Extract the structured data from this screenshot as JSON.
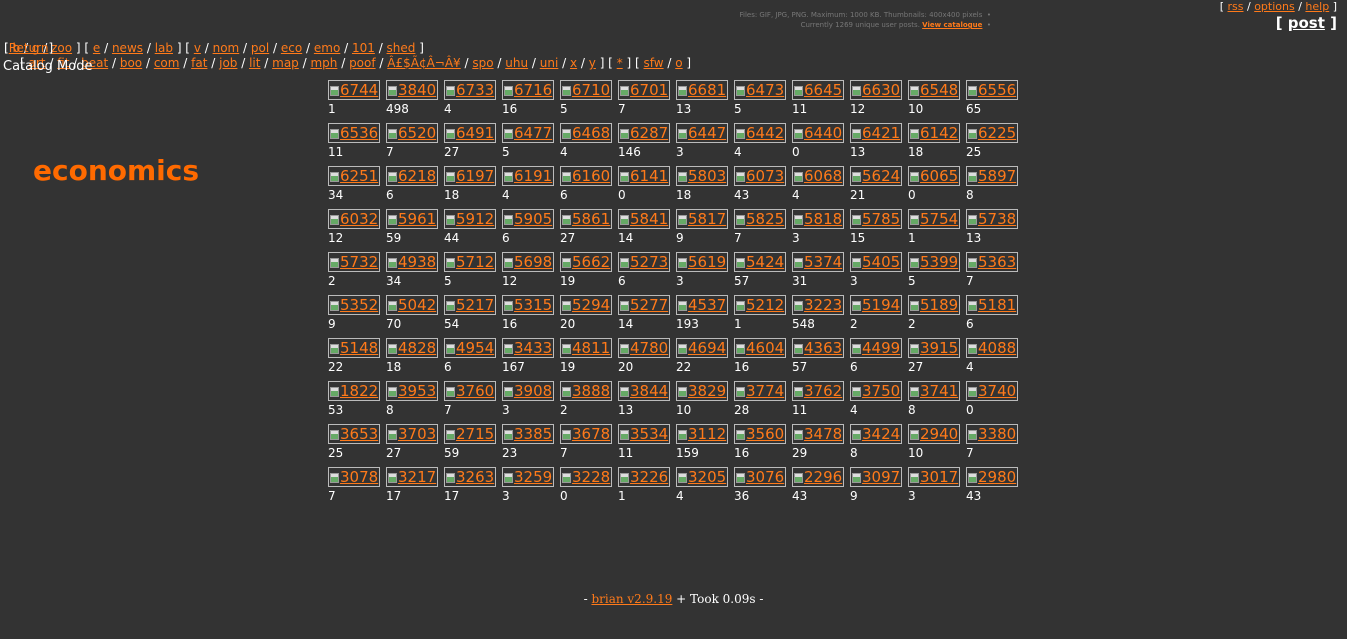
{
  "top": {
    "rss": "rss",
    "options": "options",
    "help": "help",
    "post": "post"
  },
  "info": {
    "line1": "Files: GIF, JPG, PNG. Maximum: 1000 KB. Thumbnails: 400x400 pixels",
    "line2": "Currently 1269 unique user posts.",
    "catalogue": "View catalogue"
  },
  "nav": {
    "row1": [
      "b",
      "g",
      "zoo",
      "e",
      "news",
      "lab",
      "v",
      "nom",
      "pol",
      "eco",
      "emo",
      "101",
      "shed"
    ],
    "row2": [
      "art",
      "fit",
      "beat",
      "boo",
      "com",
      "fat",
      "job",
      "lit",
      "map",
      "mph",
      "poof",
      "Â£$Ã¢Â¬Â¥",
      "spo",
      "uhu",
      "uni",
      "x",
      "y",
      "*",
      "sfw",
      "o"
    ]
  },
  "return_label": "Return",
  "mode_label": "Catalog Mode",
  "board_title": "economics",
  "threads": [
    {
      "id": "6744",
      "count": "1"
    },
    {
      "id": "3840",
      "count": "498"
    },
    {
      "id": "6733",
      "count": "4"
    },
    {
      "id": "6716",
      "count": "16"
    },
    {
      "id": "6710",
      "count": "5"
    },
    {
      "id": "6701",
      "count": "7"
    },
    {
      "id": "6681",
      "count": "13"
    },
    {
      "id": "6473",
      "count": "5"
    },
    {
      "id": "6645",
      "count": "11"
    },
    {
      "id": "6630",
      "count": "12"
    },
    {
      "id": "6548",
      "count": "10"
    },
    {
      "id": "6556",
      "count": "65"
    },
    {
      "id": "6536",
      "count": "11"
    },
    {
      "id": "6520",
      "count": "7"
    },
    {
      "id": "6491",
      "count": "27"
    },
    {
      "id": "6477",
      "count": "5"
    },
    {
      "id": "6468",
      "count": "4"
    },
    {
      "id": "6287",
      "count": "146"
    },
    {
      "id": "6447",
      "count": "3"
    },
    {
      "id": "6442",
      "count": "4"
    },
    {
      "id": "6440",
      "count": "0"
    },
    {
      "id": "6421",
      "count": "13"
    },
    {
      "id": "6142",
      "count": "18"
    },
    {
      "id": "6225",
      "count": "25"
    },
    {
      "id": "6251",
      "count": "34"
    },
    {
      "id": "6218",
      "count": "6"
    },
    {
      "id": "6197",
      "count": "18"
    },
    {
      "id": "6191",
      "count": "4"
    },
    {
      "id": "6160",
      "count": "6"
    },
    {
      "id": "6141",
      "count": "0"
    },
    {
      "id": "5803",
      "count": "18"
    },
    {
      "id": "6073",
      "count": "43"
    },
    {
      "id": "6068",
      "count": "4"
    },
    {
      "id": "5624",
      "count": "21"
    },
    {
      "id": "6065",
      "count": "0"
    },
    {
      "id": "5897",
      "count": "8"
    },
    {
      "id": "6032",
      "count": "12"
    },
    {
      "id": "5961",
      "count": "59"
    },
    {
      "id": "5912",
      "count": "44"
    },
    {
      "id": "5905",
      "count": "6"
    },
    {
      "id": "5861",
      "count": "27"
    },
    {
      "id": "5841",
      "count": "14"
    },
    {
      "id": "5817",
      "count": "9"
    },
    {
      "id": "5825",
      "count": "7"
    },
    {
      "id": "5818",
      "count": "3"
    },
    {
      "id": "5785",
      "count": "15"
    },
    {
      "id": "5754",
      "count": "1"
    },
    {
      "id": "5738",
      "count": "13"
    },
    {
      "id": "5732",
      "count": "2"
    },
    {
      "id": "4938",
      "count": "34"
    },
    {
      "id": "5712",
      "count": "5"
    },
    {
      "id": "5698",
      "count": "12"
    },
    {
      "id": "5662",
      "count": "19"
    },
    {
      "id": "5273",
      "count": "6"
    },
    {
      "id": "5619",
      "count": "3"
    },
    {
      "id": "5424",
      "count": "57"
    },
    {
      "id": "5374",
      "count": "31"
    },
    {
      "id": "5405",
      "count": "3"
    },
    {
      "id": "5399",
      "count": "5"
    },
    {
      "id": "5363",
      "count": "7"
    },
    {
      "id": "5352",
      "count": "9"
    },
    {
      "id": "5042",
      "count": "70"
    },
    {
      "id": "5217",
      "count": "54"
    },
    {
      "id": "5315",
      "count": "16"
    },
    {
      "id": "5294",
      "count": "20"
    },
    {
      "id": "5277",
      "count": "14"
    },
    {
      "id": "4537",
      "count": "193"
    },
    {
      "id": "5212",
      "count": "1"
    },
    {
      "id": "3223",
      "count": "548"
    },
    {
      "id": "5194",
      "count": "2"
    },
    {
      "id": "5189",
      "count": "2"
    },
    {
      "id": "5181",
      "count": "6"
    },
    {
      "id": "5148",
      "count": "22"
    },
    {
      "id": "4828",
      "count": "18"
    },
    {
      "id": "4954",
      "count": "6"
    },
    {
      "id": "3433",
      "count": "167"
    },
    {
      "id": "4811",
      "count": "19"
    },
    {
      "id": "4780",
      "count": "20"
    },
    {
      "id": "4694",
      "count": "22"
    },
    {
      "id": "4604",
      "count": "16"
    },
    {
      "id": "4363",
      "count": "57"
    },
    {
      "id": "4499",
      "count": "6"
    },
    {
      "id": "3915",
      "count": "27"
    },
    {
      "id": "4088",
      "count": "4"
    },
    {
      "id": "1822",
      "count": "53"
    },
    {
      "id": "3953",
      "count": "8"
    },
    {
      "id": "3760",
      "count": "7"
    },
    {
      "id": "3908",
      "count": "3"
    },
    {
      "id": "3888",
      "count": "2"
    },
    {
      "id": "3844",
      "count": "13"
    },
    {
      "id": "3829",
      "count": "10"
    },
    {
      "id": "3774",
      "count": "28"
    },
    {
      "id": "3762",
      "count": "11"
    },
    {
      "id": "3750",
      "count": "4"
    },
    {
      "id": "3741",
      "count": "8"
    },
    {
      "id": "3740",
      "count": "0"
    },
    {
      "id": "3653",
      "count": "25"
    },
    {
      "id": "3703",
      "count": "27"
    },
    {
      "id": "2715",
      "count": "59"
    },
    {
      "id": "3385",
      "count": "23"
    },
    {
      "id": "3678",
      "count": "7"
    },
    {
      "id": "3534",
      "count": "11"
    },
    {
      "id": "3112",
      "count": "159"
    },
    {
      "id": "3560",
      "count": "16"
    },
    {
      "id": "3478",
      "count": "29"
    },
    {
      "id": "3424",
      "count": "8"
    },
    {
      "id": "2940",
      "count": "10"
    },
    {
      "id": "3380",
      "count": "7"
    },
    {
      "id": "3078",
      "count": "7"
    },
    {
      "id": "3217",
      "count": "17"
    },
    {
      "id": "3263",
      "count": "17"
    },
    {
      "id": "3259",
      "count": "3"
    },
    {
      "id": "3228",
      "count": "0"
    },
    {
      "id": "3226",
      "count": "1"
    },
    {
      "id": "3205",
      "count": "4"
    },
    {
      "id": "3076",
      "count": "36"
    },
    {
      "id": "2296",
      "count": "43"
    },
    {
      "id": "3097",
      "count": "9"
    },
    {
      "id": "3017",
      "count": "3"
    },
    {
      "id": "2980",
      "count": "43"
    }
  ],
  "footer": {
    "prefix": "- ",
    "link": "brian v2.9.19",
    "suffix": " + Took 0.09s -"
  }
}
